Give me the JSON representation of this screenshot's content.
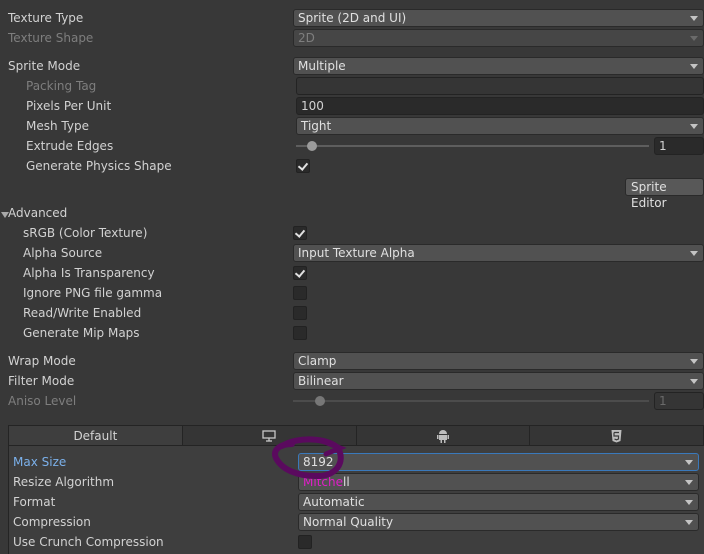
{
  "general": {
    "texture_type": {
      "label": "Texture Type",
      "value": "Sprite (2D and UI)"
    },
    "texture_shape": {
      "label": "Texture Shape",
      "value": "2D"
    },
    "sprite_mode": {
      "label": "Sprite Mode",
      "value": "Multiple"
    },
    "packing_tag": {
      "label": "Packing Tag",
      "value": ""
    },
    "pixels_per_unit": {
      "label": "Pixels Per Unit",
      "value": "100"
    },
    "mesh_type": {
      "label": "Mesh Type",
      "value": "Tight"
    },
    "extrude_edges": {
      "label": "Extrude Edges",
      "value": "1",
      "slider_fraction": 0.0625
    },
    "generate_physics_shape": {
      "label": "Generate Physics Shape",
      "checked": true
    },
    "sprite_editor_button": "Sprite Editor"
  },
  "advanced": {
    "header": "Advanced",
    "srgb": {
      "label": "sRGB (Color Texture)",
      "checked": true
    },
    "alpha_source": {
      "label": "Alpha Source",
      "value": "Input Texture Alpha"
    },
    "alpha_is_transparency": {
      "label": "Alpha Is Transparency",
      "checked": true
    },
    "ignore_png_gamma": {
      "label": "Ignore PNG file gamma",
      "checked": false
    },
    "read_write": {
      "label": "Read/Write Enabled",
      "checked": false
    },
    "mip_maps": {
      "label": "Generate Mip Maps",
      "checked": false
    }
  },
  "sampling": {
    "wrap_mode": {
      "label": "Wrap Mode",
      "value": "Clamp"
    },
    "filter_mode": {
      "label": "Filter Mode",
      "value": "Bilinear"
    },
    "aniso_level": {
      "label": "Aniso Level",
      "value": "1",
      "slider_fraction": 0.08
    }
  },
  "platform_tabs": [
    {
      "label": "Default",
      "icon": "none",
      "active": true
    },
    {
      "label": "",
      "icon": "monitor-icon",
      "active": false
    },
    {
      "label": "",
      "icon": "android-icon",
      "active": false
    },
    {
      "label": "",
      "icon": "html5-icon",
      "active": false
    }
  ],
  "platform": {
    "max_size": {
      "label": "Max Size",
      "value": "8192"
    },
    "resize_algorithm": {
      "label": "Resize Algorithm",
      "value_highlight": "Mitche",
      "value_rest": "ll"
    },
    "format": {
      "label": "Format",
      "value": "Automatic"
    },
    "compression": {
      "label": "Compression",
      "value": "Normal Quality"
    },
    "crunch": {
      "label": "Use Crunch Compression",
      "checked": false
    }
  },
  "annotation": {
    "color": "#5a0a5e"
  }
}
